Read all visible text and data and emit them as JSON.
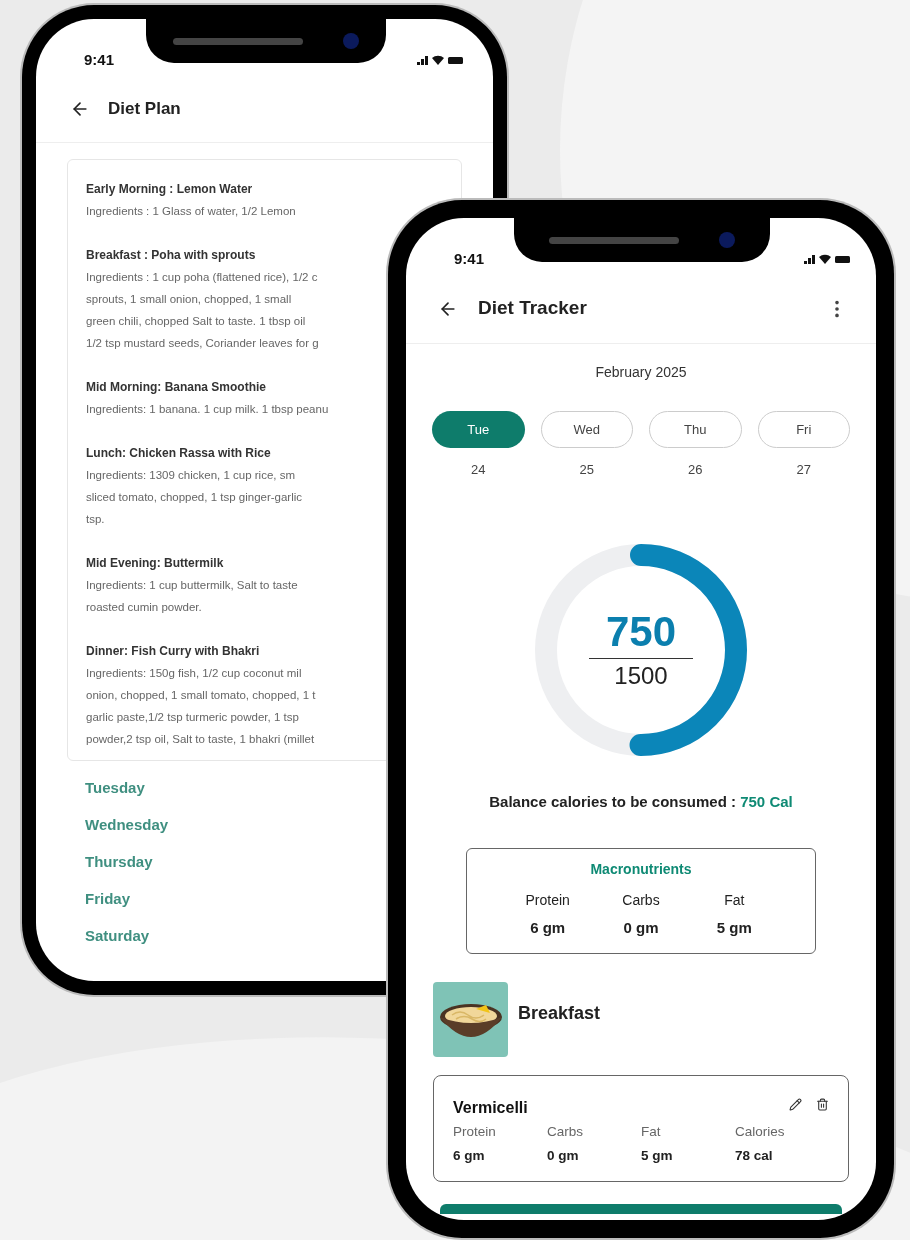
{
  "diet_plan": {
    "status_time": "9:41",
    "title": "Diet Plan",
    "meals": [
      {
        "heading": "Early Morning : Lemon Water",
        "lines": [
          "Ingredients : 1 Glass of water, 1/2 Lemon"
        ]
      },
      {
        "heading": "Breakfast : Poha with sprouts",
        "lines": [
          "Ingredients : 1 cup poha (flattened rice), 1/2 c",
          "sprouts, 1 small onion, chopped, 1 small",
          "green chili, chopped Salt to taste. 1 tbsp oil",
          "1/2 tsp mustard seeds, Coriander leaves for g"
        ]
      },
      {
        "heading": "Mid Morning: Banana Smoothie",
        "lines": [
          "Ingredients: 1 banana. 1 cup milk. 1 tbsp peanu"
        ]
      },
      {
        "heading": "Lunch: Chicken Rassa with Rice",
        "lines": [
          "Ingredients: 1309 chicken, 1 cup rice, sm",
          "sliced tomato, chopped, 1 tsp ginger-garlic",
          "tsp."
        ]
      },
      {
        "heading": "Mid Evening: Buttermilk",
        "lines": [
          "Ingredients: 1 cup buttermilk, Salt to taste",
          "roasted cumin powder."
        ]
      },
      {
        "heading": "Dinner: Fish Curry with Bhakri",
        "lines": [
          "Ingredients: 150g fish, 1/2 cup coconut mil",
          "onion, chopped, 1 small tomato, chopped, 1 t",
          "garlic paste,1/2 tsp turmeric powder, 1 tsp",
          "powder,2 tsp oil, Salt to taste, 1 bhakri (millet"
        ]
      }
    ],
    "days": [
      "Tuesday",
      "Wednesday",
      "Thursday",
      "Friday",
      "Saturday"
    ]
  },
  "diet_tracker": {
    "status_time": "9:41",
    "title": "Diet Tracker",
    "month": "February 2025",
    "days": [
      {
        "day": "Tue",
        "date": "24",
        "selected": true
      },
      {
        "day": "Wed",
        "date": "25",
        "selected": false
      },
      {
        "day": "Thu",
        "date": "26",
        "selected": false
      },
      {
        "day": "Fri",
        "date": "27",
        "selected": false
      }
    ],
    "gauge": {
      "level": 0.5,
      "consumed": "750",
      "total": "1500"
    },
    "balance": {
      "label": "Balance calories to be consumed : ",
      "value": "750 Cal"
    },
    "macros": {
      "title": "Macronutrients",
      "items": [
        {
          "label": "Protein",
          "value": "6 gm"
        },
        {
          "label": "Carbs",
          "value": "0 gm"
        },
        {
          "label": "Fat",
          "value": "5 gm"
        }
      ]
    },
    "meal": {
      "name": "Breakfast",
      "foods": [
        {
          "name": "Vermicelli",
          "stats": [
            {
              "label": "Protein",
              "value": "6 gm"
            },
            {
              "label": "Carbs",
              "value": "0 gm"
            },
            {
              "label": "Fat",
              "value": "5 gm"
            },
            {
              "label": "Calories",
              "value": "78 cal"
            }
          ]
        }
      ]
    }
  }
}
